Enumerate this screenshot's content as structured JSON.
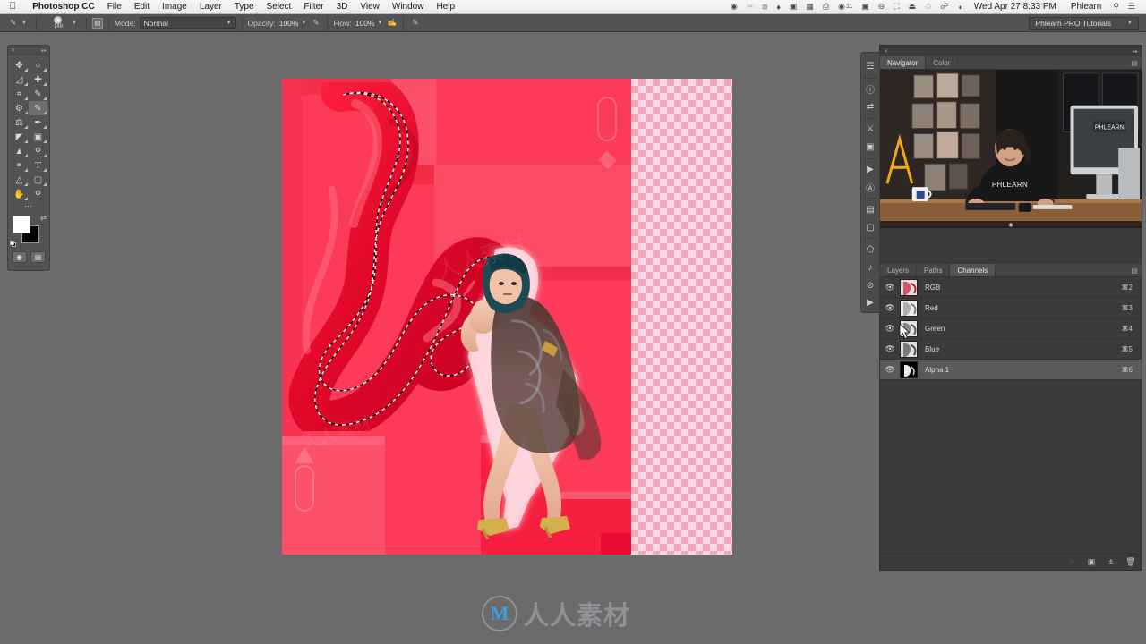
{
  "menubar": {
    "apple_icon": "apple-icon",
    "app_name": "Photoshop CC",
    "items": [
      "File",
      "Edit",
      "Image",
      "Layer",
      "Type",
      "Select",
      "Filter",
      "3D",
      "View",
      "Window",
      "Help"
    ],
    "status_icons": [
      "record-icon",
      "scissors-icon",
      "dropbox-icon",
      "evernote-icon",
      "screenshot-icon",
      "grid-icon",
      "printer-icon",
      "eye-count-icon"
    ],
    "eye_count": "11",
    "status_icons_2": [
      "battery-icon",
      "dnd-icon",
      "airplay-icon",
      "eject-icon",
      "timemachine-icon",
      "bluetooth-icon",
      "wifi-icon"
    ],
    "clock": "Wed Apr 27  8:33 PM",
    "user": "Phlearn",
    "search_icon": "search-icon",
    "notification_icon": "notification-center-icon"
  },
  "optionsbar": {
    "tool_icon": "brush-tool-icon",
    "brush_size": "148",
    "brush_preset_icon": "brush-preset-picker-icon",
    "mode_label": "Mode:",
    "mode_value": "Normal",
    "opacity_label": "Opacity:",
    "opacity_value": "100%",
    "opacity_pressure_icon": "pressure-opacity-icon",
    "flow_label": "Flow:",
    "flow_value": "100%",
    "airbrush_icon": "airbrush-icon",
    "smoothing_icon": "smoothing-icon",
    "workspace": "Phlearn PRO Tutorials"
  },
  "toolbar": {
    "close_icon": "close-icon",
    "collapse_icon": "collapse-icon",
    "tools": [
      {
        "name": "move-tool",
        "glyph": "✥"
      },
      {
        "name": "marquee-tool",
        "glyph": "◌"
      },
      {
        "name": "lasso-tool",
        "glyph": "ᗕ"
      },
      {
        "name": "quick-selection-tool",
        "glyph": "🖌"
      },
      {
        "name": "crop-tool",
        "glyph": "⌗"
      },
      {
        "name": "eyedropper-tool",
        "glyph": "✒"
      },
      {
        "name": "healing-brush-tool",
        "glyph": "⌁"
      },
      {
        "name": "brush-tool",
        "glyph": "🖌",
        "selected": true
      },
      {
        "name": "clone-stamp-tool",
        "glyph": "⚱"
      },
      {
        "name": "history-brush-tool",
        "glyph": "🖌"
      },
      {
        "name": "eraser-tool",
        "glyph": "◣"
      },
      {
        "name": "gradient-tool",
        "glyph": "▤"
      },
      {
        "name": "blur-tool",
        "glyph": "▲"
      },
      {
        "name": "dodge-tool",
        "glyph": "🔍"
      },
      {
        "name": "pen-tool",
        "glyph": "✎"
      },
      {
        "name": "type-tool",
        "glyph": "T"
      },
      {
        "name": "path-selection-tool",
        "glyph": "➤"
      },
      {
        "name": "rectangle-tool",
        "glyph": "▭"
      },
      {
        "name": "direct-selection-tool",
        "glyph": "➤"
      },
      {
        "name": "shape-tool",
        "glyph": "▭"
      },
      {
        "name": "hand-tool",
        "glyph": "✋"
      },
      {
        "name": "zoom-tool",
        "glyph": "🔍"
      }
    ],
    "more_tools_icon": "more-tools-icon",
    "foreground_color": "#ffffff",
    "background_color": "#000000",
    "swap_colors_icon": "swap-colors-icon",
    "default_colors_icon": "default-colors-icon",
    "quickmask_icon": "quick-mask-icon",
    "screenmode_icon": "screen-mode-icon"
  },
  "dock": {
    "close_icon": "close-icon",
    "collapse_icon": "collapse-icon",
    "rail_icons": [
      "brush-panel-icon",
      "info-panel-icon",
      "adjustments-panel-icon",
      "libraries-panel-icon",
      "styles-panel-icon",
      "actions-panel-icon",
      "character-panel-icon",
      "history-panel-icon",
      "notes-panel-icon",
      "3d-panel-icon",
      "paths-icon",
      "no-icon",
      "play-icon"
    ],
    "top_group": {
      "tabs": [
        {
          "label": "Navigator",
          "active": true
        },
        {
          "label": "Color",
          "active": false
        }
      ],
      "menu_icon": "panel-menu-icon",
      "preview_name": "navigator-video-preview",
      "video_brand": "PHLEARN"
    },
    "bottom_group": {
      "tabs": [
        {
          "label": "Layers",
          "active": false
        },
        {
          "label": "Paths",
          "active": false
        },
        {
          "label": "Channels",
          "active": true
        }
      ],
      "menu_icon": "panel-menu-icon",
      "channels": [
        {
          "name": "RGB",
          "shortcut": "⌘2",
          "visible": true,
          "selected": false,
          "thumb": "color"
        },
        {
          "name": "Red",
          "shortcut": "⌘3",
          "visible": true,
          "selected": false,
          "thumb": "gray"
        },
        {
          "name": "Green",
          "shortcut": "⌘4",
          "visible": true,
          "selected": false,
          "thumb": "gray"
        },
        {
          "name": "Blue",
          "shortcut": "⌘5",
          "visible": true,
          "selected": false,
          "thumb": "gray"
        },
        {
          "name": "Alpha 1",
          "shortcut": "⌘6",
          "visible": true,
          "selected": true,
          "thumb": "alpha"
        }
      ],
      "footer_icons": [
        "load-channel-as-selection-icon",
        "save-selection-as-channel-icon",
        "create-new-channel-icon",
        "delete-channel-icon"
      ]
    }
  },
  "canvas": {
    "document_name": "fashion-composite",
    "selection_active": true,
    "selection_label": "marching-ants-selection",
    "background_color": "#fb3b58",
    "transparency_checker": "checkerboard-transparency",
    "subject": "model-in-sheer-dress",
    "fabric": "red-silk-fabric"
  },
  "watermark": {
    "text": "人人素材",
    "logo_letter": "M"
  }
}
